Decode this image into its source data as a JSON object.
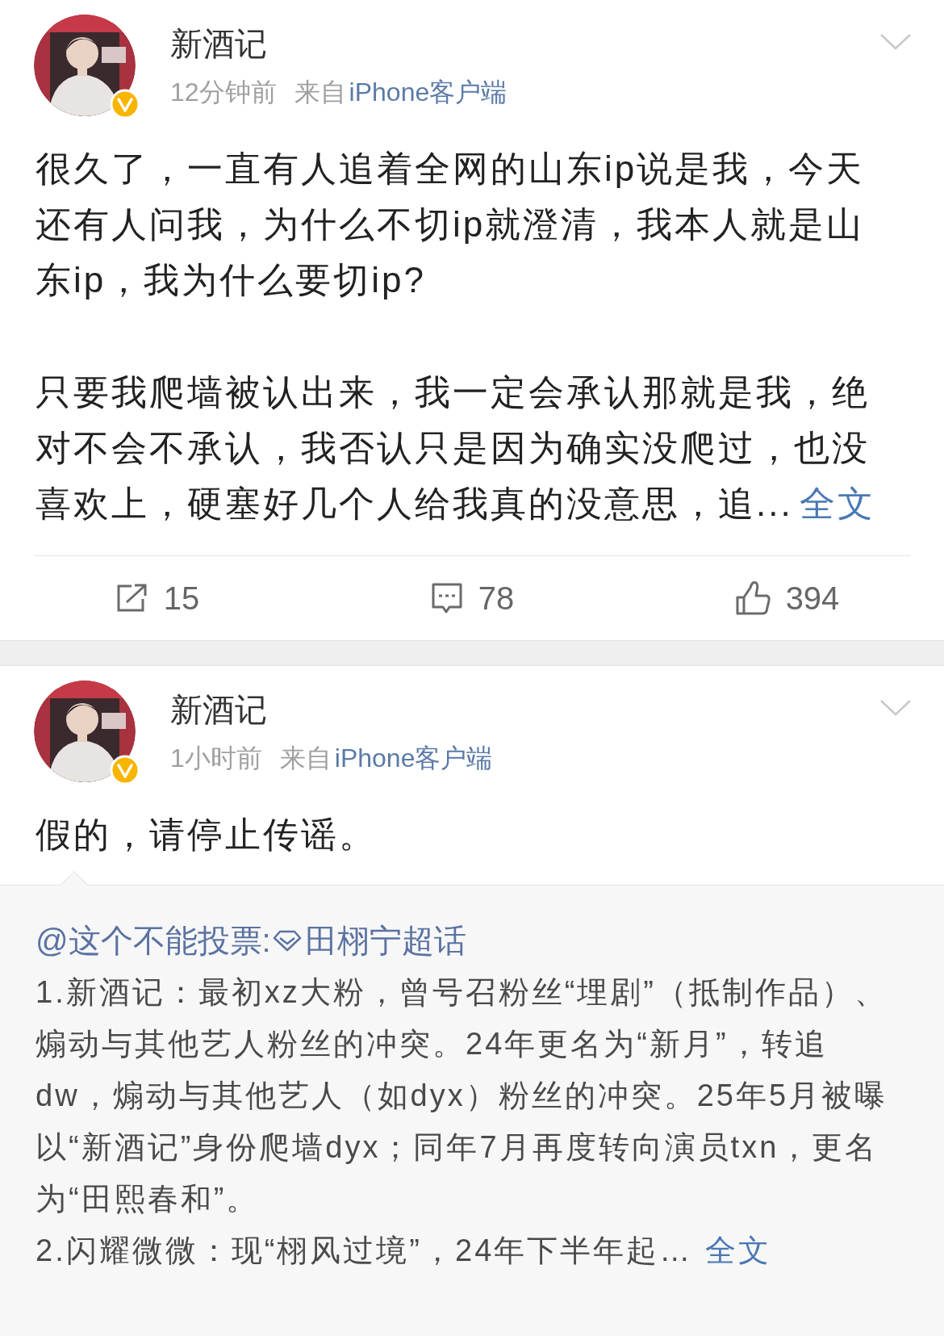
{
  "posts": [
    {
      "author": "新酒记",
      "verified": true,
      "time": "12分钟前",
      "source_prefix": "来自",
      "source": "iPhone客户端",
      "paragraphs": [
        "很久了，一直有人追着全网的山东ip说是我，今天还有人问我，为什么不切ip就澄清，我本人就是山东ip，我为什么要切ip?",
        "只要我爬墙被认出来，我一定会承认那就是我，绝对不会不承认，我否认只是因为确实没爬过，也没喜欢上，硬塞好几个人给我真的没意思，追..."
      ],
      "more_link": "全文",
      "actions": {
        "reposts": "15",
        "comments": "78",
        "likes": "394"
      }
    },
    {
      "author": "新酒记",
      "verified": true,
      "time": "1小时前",
      "source_prefix": "来自",
      "source": "iPhone客户端",
      "paragraphs": [
        "假的，请停止传谣。"
      ],
      "repost": {
        "mention": "@这个不能投票:",
        "topic": "田栩宁超话",
        "paragraphs": [
          "1.新酒记：最初xz大粉，曾号召粉丝“埋剧”（抵制作品）、煽动与其他艺人粉丝的冲突。24年更名为“新月”，转追dw，煽动与其他艺人（如dyx）粉丝的冲突。25年5月被曝以“新酒记”身份爬墙dyx；同年7月再度转向演员txn，更名为“田熙春和”。",
          "2.闪耀微微：现“栩风过境”，24年下半年起…"
        ],
        "more_link": "全文"
      }
    }
  ]
}
